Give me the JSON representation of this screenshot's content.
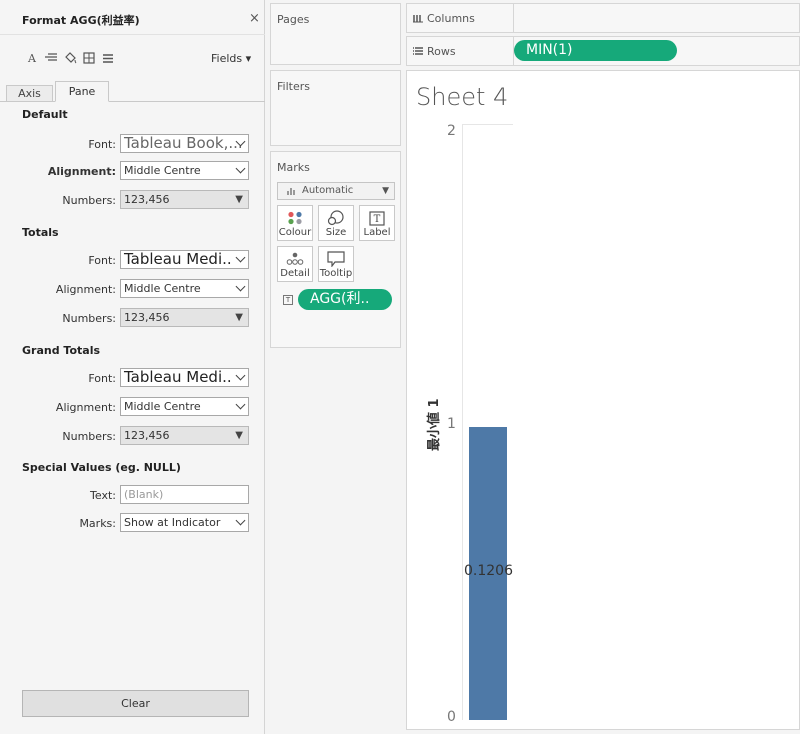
{
  "format_pane": {
    "title": "Format AGG(利益率)",
    "close_symbol": "×",
    "fields_label": "Fields ▾",
    "tabs": {
      "axis": "Axis",
      "pane": "Pane"
    },
    "sections": {
      "default": {
        "heading": "Default",
        "font_label": "Font:",
        "font_value": "Tableau Book,...",
        "alignment_label": "Alignment:",
        "alignment_value": "Middle Centre",
        "numbers_label": "Numbers:",
        "numbers_value": "123,456"
      },
      "totals": {
        "heading": "Totals",
        "font_label": "Font:",
        "font_value": "Tableau Medi..",
        "alignment_label": "Alignment:",
        "alignment_value": "Middle Centre",
        "numbers_label": "Numbers:",
        "numbers_value": "123,456"
      },
      "grand_totals": {
        "heading": "Grand Totals",
        "font_label": "Font:",
        "font_value": "Tableau Medi..",
        "alignment_label": "Alignment:",
        "alignment_value": "Middle Centre",
        "numbers_label": "Numbers:",
        "numbers_value": "123,456"
      },
      "special_values": {
        "heading": "Special Values (eg. NULL)",
        "text_label": "Text:",
        "text_placeholder": "(Blank)",
        "marks_label": "Marks:",
        "marks_value": "Show at Indicator"
      }
    },
    "clear_label": "Clear"
  },
  "cards": {
    "pages": "Pages",
    "filters": "Filters",
    "marks": {
      "title": "Marks",
      "mark_type": "Automatic",
      "buttons": {
        "colour": "Colour",
        "size": "Size",
        "label": "Label",
        "detail": "Detail",
        "tooltip": "Tooltip"
      },
      "label_pill": "AGG(利.."
    }
  },
  "shelves": {
    "columns_label": "Columns",
    "rows_label": "Rows",
    "rows_pill": "MIN(1)"
  },
  "sheet": {
    "title": "Sheet 4"
  },
  "chart_data": {
    "type": "bar",
    "categories": [
      ""
    ],
    "values": [
      1
    ],
    "data_labels": [
      "0.1206"
    ],
    "ylabel": "最小値 1",
    "yticks": [
      "0",
      "1",
      "2"
    ],
    "ylim": [
      0,
      2
    ],
    "color": "#4e79a7"
  },
  "colors": {
    "pill": "#16a97a",
    "bar": "#4e79a7"
  }
}
